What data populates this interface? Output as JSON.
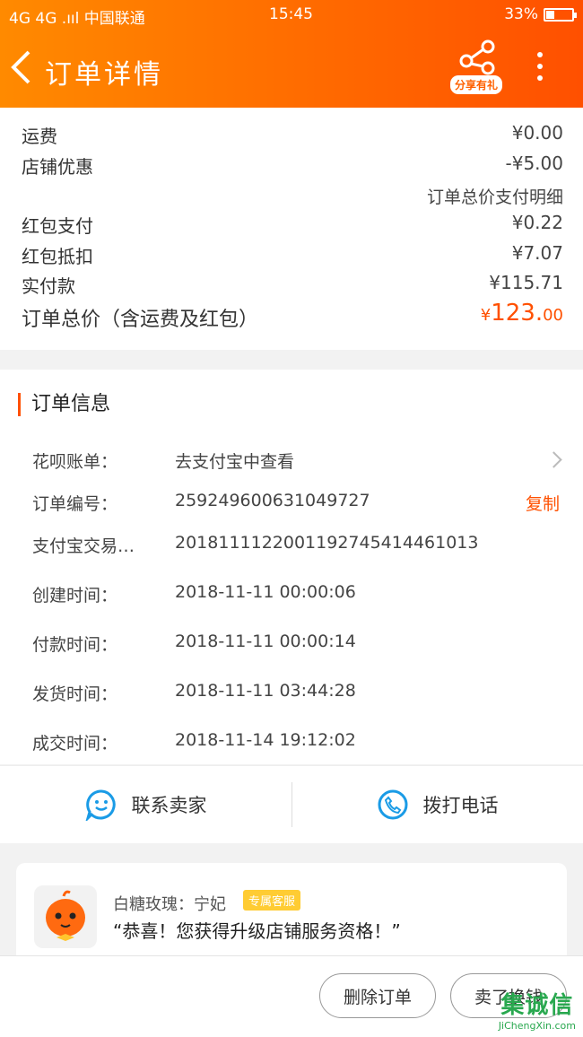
{
  "status_bar": {
    "network": "4G 4G .ııl",
    "carrier": "中国联通",
    "time": "15:45",
    "battery_percent": 33,
    "battery_label": "33%"
  },
  "header": {
    "back_icon": "chevron-left-icon",
    "title": "订单详情",
    "share_badge": "分享有礼",
    "more_icon": "more-vertical-icon"
  },
  "price_detail": {
    "rows": [
      {
        "label": "运费",
        "value": "¥0.00"
      },
      {
        "label": "店铺优惠",
        "value": "-¥5.00"
      },
      {
        "label": "红包支付",
        "value": "¥0.22"
      },
      {
        "label": "红包抵扣",
        "value": "¥7.07"
      },
      {
        "label": "实付款",
        "value": "¥115.71"
      }
    ],
    "detail_link": "订单总价支付明细",
    "total_label": "订单总价（含运费及红包）",
    "total_currency": "¥",
    "total_int": "123.",
    "total_dec": "00"
  },
  "order_info": {
    "section_title": "订单信息",
    "rows": [
      {
        "label": "花呗账单：",
        "value": "去支付宝中查看"
      },
      {
        "label": "订单编号：",
        "value": "259249600631049727"
      },
      {
        "label": "支付宝交易…",
        "value": "2018111122001192745414461013"
      },
      {
        "label": "创建时间：",
        "value": "2018-11-11 00:00:06"
      },
      {
        "label": "付款时间：",
        "value": "2018-11-11 00:00:14"
      },
      {
        "label": "发货时间：",
        "value": "2018-11-11 03:44:28"
      },
      {
        "label": "成交时间：",
        "value": "2018-11-14 19:12:02"
      }
    ],
    "copy_label": "复制"
  },
  "contact": {
    "seller_label": "联系卖家",
    "phone_label": "拨打电话"
  },
  "message": {
    "sender": "白糖玫瑰：宁妃",
    "badge": "专属客服",
    "text": "“恭喜！您获得升级店铺服务资格！”"
  },
  "bottom": {
    "delete_label": "删除订单",
    "second_label": "卖了换钱"
  },
  "watermark": {
    "brand": "集诚信",
    "url": "JiChengXin.com"
  },
  "colors": {
    "accent": "#ff5000",
    "header_start": "#ff8a00",
    "link_blue": "#1a9be6",
    "watermark": "#29a84f"
  }
}
